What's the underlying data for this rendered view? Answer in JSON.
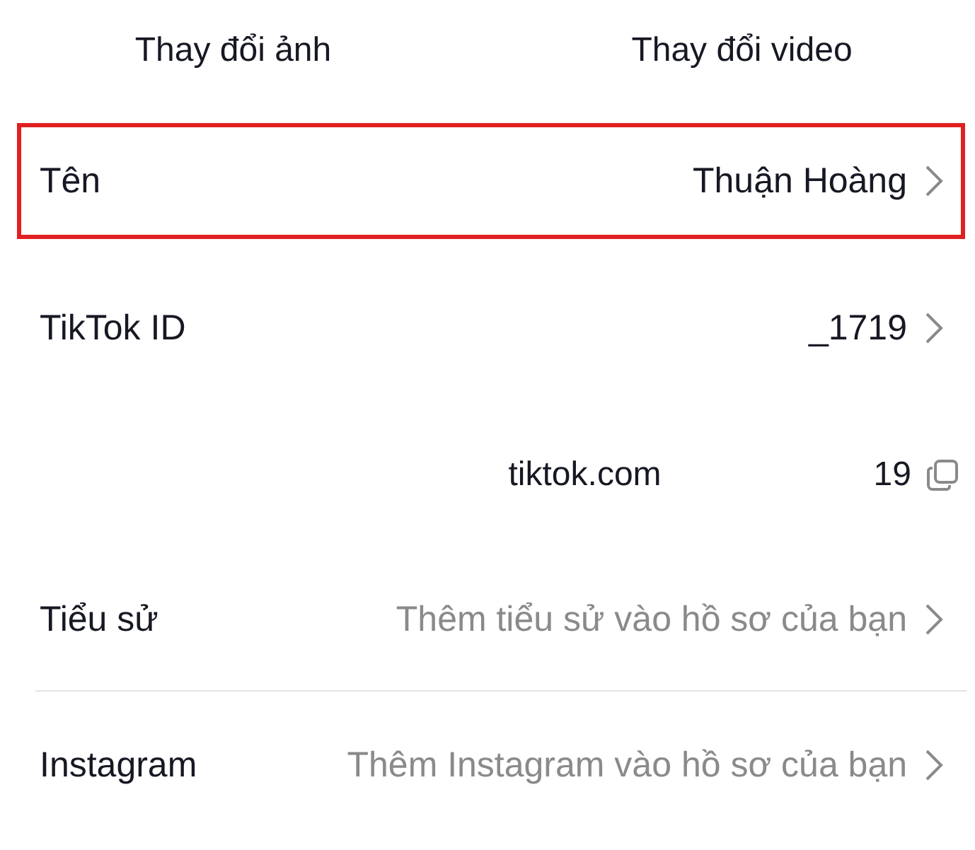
{
  "media_actions": [
    {
      "label": "Thay đổi ảnh"
    },
    {
      "label": "Thay đổi video"
    }
  ],
  "fields": [
    {
      "kind": "nav",
      "label": "Tên",
      "value": "Thuận Hoàng",
      "highlighted": true
    },
    {
      "kind": "nav",
      "label": "TikTok ID",
      "value": "_1719",
      "highlighted": false
    },
    {
      "kind": "link",
      "url_start": "tiktok.com",
      "url_end": "19"
    },
    {
      "kind": "nav",
      "label": "Tiểu sử",
      "placeholder": "Thêm tiểu sử vào hồ sơ của bạn",
      "highlighted": false
    },
    {
      "kind": "divider"
    },
    {
      "kind": "nav",
      "label": "Instagram",
      "placeholder": "Thêm Instagram vào hồ sơ của bạn",
      "highlighted": false
    }
  ]
}
